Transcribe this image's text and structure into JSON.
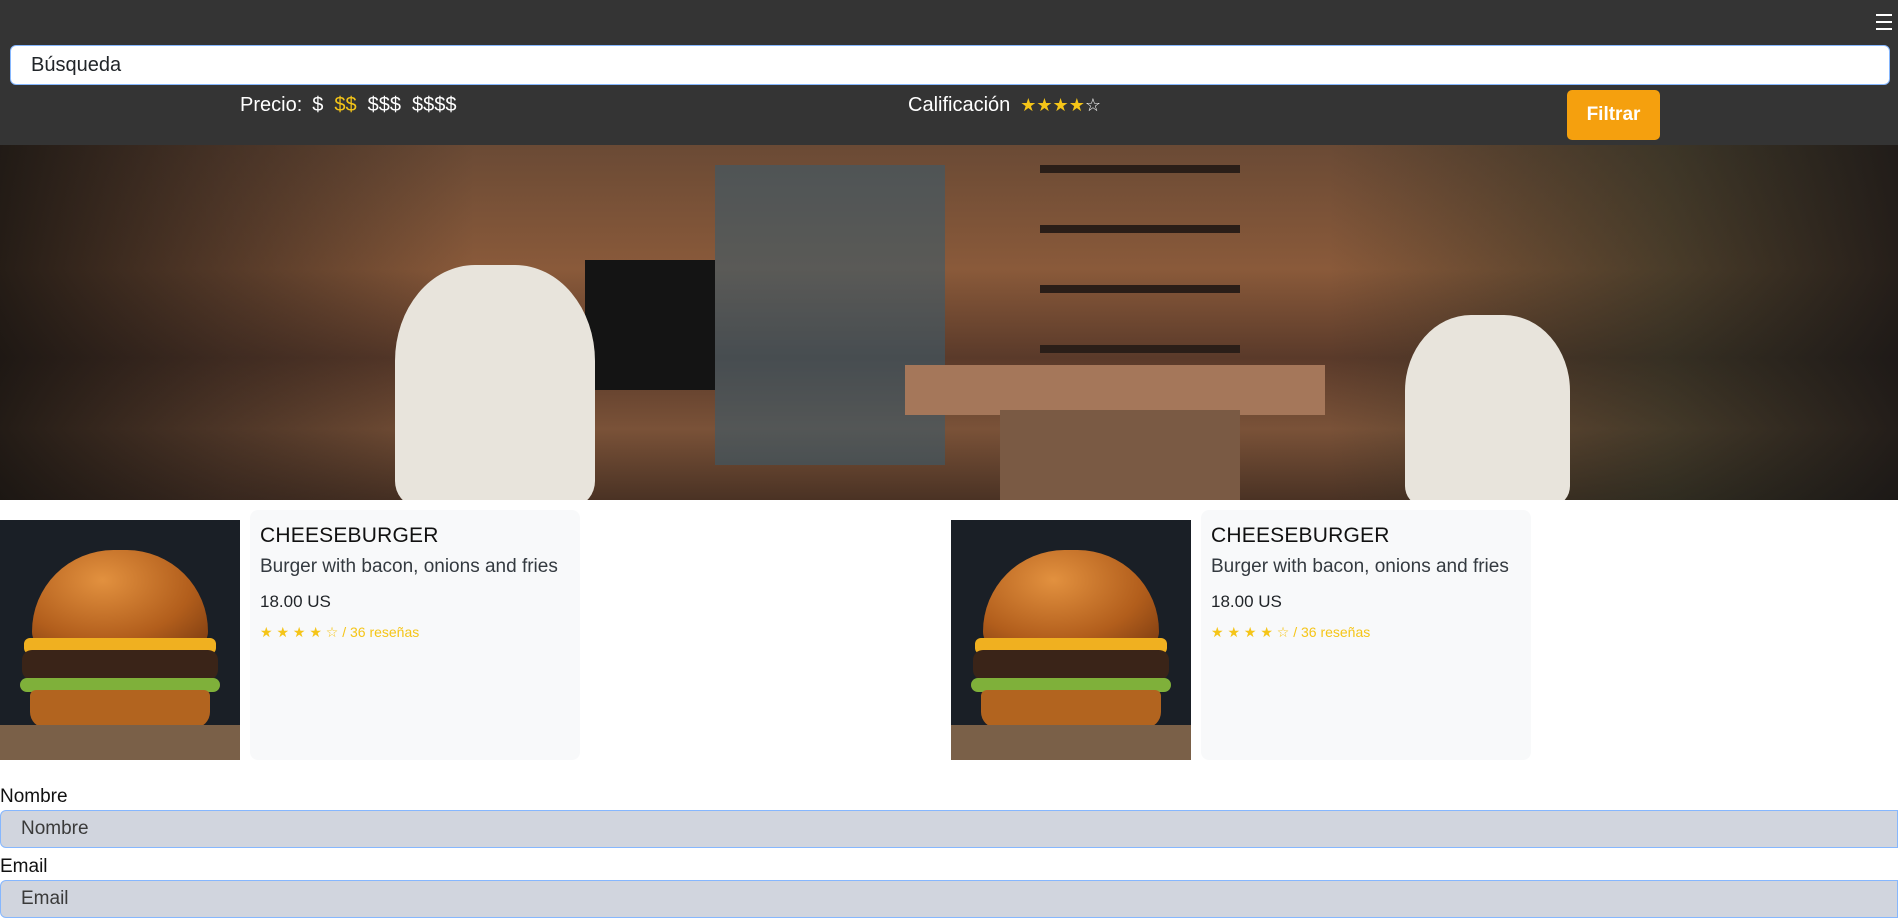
{
  "header": {
    "menu_icon": "hamburger-menu-icon",
    "search_placeholder": "Búsqueda",
    "price_label": "Precio:",
    "price_options": [
      "$",
      "$$",
      "$$$",
      "$$$$"
    ],
    "price_selected": "$$",
    "rating_label": "Calificación",
    "rating_stars": [
      "★",
      "★",
      "★",
      "★",
      "☆"
    ],
    "filter_button": "Filtrar",
    "colors": {
      "background": "#343434",
      "accent": "#f5a00e",
      "star": "#f5c518"
    }
  },
  "hero": {
    "image": "coffee-shop-interior-photo"
  },
  "products": [
    {
      "image": "cheeseburger-photo",
      "title": "CHEESEBURGER",
      "description": "Burger with bacon, onions and fries",
      "price": "18.00 US",
      "rating_text": "★ ★ ★ ★ ☆ / 36 reseñas"
    },
    {
      "image": "cheeseburger-photo",
      "title": "CHEESEBURGER",
      "description": "Burger with bacon, onions and fries",
      "price": "18.00 US",
      "rating_text": "★ ★ ★ ★ ☆ / 36 reseñas"
    }
  ],
  "form": {
    "name_label": "Nombre",
    "name_placeholder": "Nombre",
    "email_label": "Email",
    "email_placeholder": "Email"
  }
}
